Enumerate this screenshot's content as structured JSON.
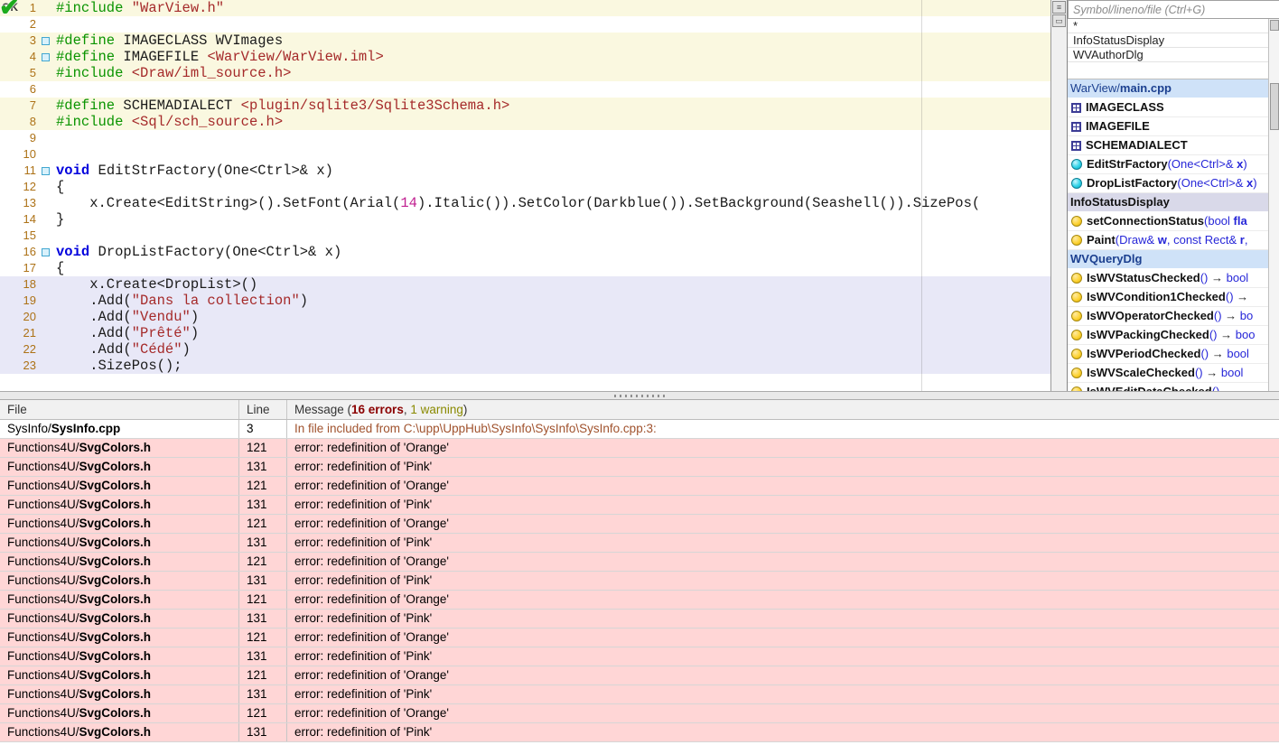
{
  "colors": {
    "error_row_bg": "#ffd6d6",
    "errors_text": "#8b0000",
    "warning_text": "#8a8a00",
    "selection_bg": "#d9d9e9",
    "file_row_bg": "#cfe2f8"
  },
  "editor": {
    "status": "OK",
    "lines": [
      {
        "num": "1",
        "bg": "y",
        "marker": false,
        "segments": [
          {
            "t": "#include",
            "c": "pp"
          },
          {
            "t": " ",
            "c": "pl"
          },
          {
            "t": "\"WarView.h\"",
            "c": "str"
          }
        ]
      },
      {
        "num": "2",
        "bg": "w",
        "marker": false,
        "segments": []
      },
      {
        "num": "3",
        "bg": "y",
        "marker": true,
        "segments": [
          {
            "t": "#define",
            "c": "pp"
          },
          {
            "t": " IMAGECLASS WVImages",
            "c": "pl"
          }
        ]
      },
      {
        "num": "4",
        "bg": "y",
        "marker": true,
        "segments": [
          {
            "t": "#define",
            "c": "pp"
          },
          {
            "t": " IMAGEFILE ",
            "c": "pl"
          },
          {
            "t": "<WarView/WarView.iml>",
            "c": "str"
          }
        ]
      },
      {
        "num": "5",
        "bg": "y",
        "marker": false,
        "segments": [
          {
            "t": "#include",
            "c": "pp"
          },
          {
            "t": " ",
            "c": "pl"
          },
          {
            "t": "<Draw/iml_source.h>",
            "c": "str"
          }
        ]
      },
      {
        "num": "6",
        "bg": "w",
        "marker": false,
        "segments": []
      },
      {
        "num": "7",
        "bg": "y",
        "marker": false,
        "segments": [
          {
            "t": "#define",
            "c": "pp"
          },
          {
            "t": " SCHEMADIALECT ",
            "c": "pl"
          },
          {
            "t": "<plugin/sqlite3/Sqlite3Schema.h>",
            "c": "str"
          }
        ]
      },
      {
        "num": "8",
        "bg": "y",
        "marker": false,
        "segments": [
          {
            "t": "#include",
            "c": "pp"
          },
          {
            "t": " ",
            "c": "pl"
          },
          {
            "t": "<Sql/sch_source.h>",
            "c": "str"
          }
        ]
      },
      {
        "num": "9",
        "bg": "w",
        "marker": false,
        "segments": []
      },
      {
        "num": "10",
        "bg": "w",
        "marker": false,
        "segments": []
      },
      {
        "num": "11",
        "bg": "w",
        "marker": true,
        "segments": [
          {
            "t": "void",
            "c": "kw"
          },
          {
            "t": " EditStrFactory(One<Ctrl>& x)",
            "c": "pl"
          }
        ]
      },
      {
        "num": "12",
        "bg": "w",
        "marker": false,
        "segments": [
          {
            "t": "{",
            "c": "pl"
          }
        ]
      },
      {
        "num": "13",
        "bg": "w",
        "marker": false,
        "segments": [
          {
            "t": "    x.Create<EditString>().SetFont(Arial(",
            "c": "pl"
          },
          {
            "t": "14",
            "c": "num"
          },
          {
            "t": ").Italic()).SetColor(Darkblue()).SetBackground(Seashell()).SizePos(",
            "c": "pl"
          }
        ]
      },
      {
        "num": "14",
        "bg": "w",
        "marker": false,
        "segments": [
          {
            "t": "}",
            "c": "pl"
          }
        ]
      },
      {
        "num": "15",
        "bg": "w",
        "marker": false,
        "segments": []
      },
      {
        "num": "16",
        "bg": "w",
        "marker": true,
        "segments": [
          {
            "t": "void",
            "c": "kw"
          },
          {
            "t": " DropListFactory(One<Ctrl>& x)",
            "c": "pl"
          }
        ]
      },
      {
        "num": "17",
        "bg": "w",
        "marker": false,
        "segments": [
          {
            "t": "{",
            "c": "pl"
          }
        ]
      },
      {
        "num": "18",
        "bg": "l",
        "marker": false,
        "segments": [
          {
            "t": "    x.Create<DropList>()",
            "c": "pl"
          }
        ]
      },
      {
        "num": "19",
        "bg": "l",
        "marker": false,
        "segments": [
          {
            "t": "    .Add(",
            "c": "pl"
          },
          {
            "t": "\"Dans la collection\"",
            "c": "str"
          },
          {
            "t": ")",
            "c": "pl"
          }
        ]
      },
      {
        "num": "20",
        "bg": "l",
        "marker": false,
        "segments": [
          {
            "t": "    .Add(",
            "c": "pl"
          },
          {
            "t": "\"Vendu\"",
            "c": "str"
          },
          {
            "t": ")",
            "c": "pl"
          }
        ]
      },
      {
        "num": "21",
        "bg": "l",
        "marker": false,
        "segments": [
          {
            "t": "    .Add(",
            "c": "pl"
          },
          {
            "t": "\"Prêté\"",
            "c": "str"
          },
          {
            "t": ")",
            "c": "pl"
          }
        ]
      },
      {
        "num": "22",
        "bg": "l",
        "marker": false,
        "segments": [
          {
            "t": "    .Add(",
            "c": "pl"
          },
          {
            "t": "\"Cédé\"",
            "c": "str"
          },
          {
            "t": ")",
            "c": "pl"
          }
        ]
      },
      {
        "num": "23",
        "bg": "l",
        "marker": false,
        "segments": [
          {
            "t": "    .SizePos();",
            "c": "pl"
          }
        ]
      }
    ]
  },
  "symbol_panel": {
    "search_placeholder": "Symbol/lineno/file (Ctrl+G)",
    "recent": [
      "*",
      "InfoStatusDisplay",
      "WVAuthorDlg"
    ],
    "items": [
      {
        "kind": "file",
        "segments": [
          {
            "t": "WarView/",
            "c": "file"
          },
          {
            "t": "main.cpp",
            "c": "fileb"
          }
        ]
      },
      {
        "kind": "define",
        "segments": [
          {
            "t": "IMAGECLASS",
            "c": "name"
          }
        ]
      },
      {
        "kind": "define",
        "segments": [
          {
            "t": "IMAGEFILE",
            "c": "name"
          }
        ]
      },
      {
        "kind": "define",
        "segments": [
          {
            "t": "SCHEMADIALECT",
            "c": "name"
          }
        ]
      },
      {
        "kind": "fn-public",
        "segments": [
          {
            "t": "EditStrFactory",
            "c": "name"
          },
          {
            "t": "(One<Ctrl>& ",
            "c": "type"
          },
          {
            "t": "x",
            "c": "param"
          },
          {
            "t": ")",
            "c": "type"
          }
        ]
      },
      {
        "kind": "fn-public",
        "segments": [
          {
            "t": "DropListFactory",
            "c": "name"
          },
          {
            "t": "(One<Ctrl>& ",
            "c": "type"
          },
          {
            "t": "x",
            "c": "param"
          },
          {
            "t": ")",
            "c": "type"
          }
        ]
      },
      {
        "kind": "selected",
        "segments": [
          {
            "t": "InfoStatusDisplay",
            "c": "name"
          }
        ]
      },
      {
        "kind": "fn-protected",
        "segments": [
          {
            "t": "setConnectionStatus",
            "c": "name"
          },
          {
            "t": "(bool ",
            "c": "type"
          },
          {
            "t": "fla",
            "c": "param"
          }
        ]
      },
      {
        "kind": "fn-protected",
        "segments": [
          {
            "t": "Paint",
            "c": "name"
          },
          {
            "t": "(Draw& ",
            "c": "type"
          },
          {
            "t": "w",
            "c": "param"
          },
          {
            "t": ", const Rect& ",
            "c": "type"
          },
          {
            "t": "r",
            "c": "param"
          },
          {
            "t": ",",
            "c": "type"
          }
        ]
      },
      {
        "kind": "file",
        "segments": [
          {
            "t": "WVQueryDlg",
            "c": "fileb"
          }
        ]
      },
      {
        "kind": "fn-protected",
        "segments": [
          {
            "t": "IsWVStatusChecked",
            "c": "name"
          },
          {
            "t": "()",
            "c": "type"
          },
          {
            "t": " → ",
            "c": "arrow"
          },
          {
            "t": "bool",
            "c": "type"
          }
        ]
      },
      {
        "kind": "fn-protected",
        "segments": [
          {
            "t": "IsWVCondition1Checked",
            "c": "name"
          },
          {
            "t": "()",
            "c": "type"
          },
          {
            "t": " →",
            "c": "arrow"
          }
        ]
      },
      {
        "kind": "fn-protected",
        "segments": [
          {
            "t": "IsWVOperatorChecked",
            "c": "name"
          },
          {
            "t": "()",
            "c": "type"
          },
          {
            "t": " → ",
            "c": "arrow"
          },
          {
            "t": "bo",
            "c": "type"
          }
        ]
      },
      {
        "kind": "fn-protected",
        "segments": [
          {
            "t": "IsWVPackingChecked",
            "c": "name"
          },
          {
            "t": "()",
            "c": "type"
          },
          {
            "t": " → ",
            "c": "arrow"
          },
          {
            "t": "boo",
            "c": "type"
          }
        ]
      },
      {
        "kind": "fn-protected",
        "segments": [
          {
            "t": "IsWVPeriodChecked",
            "c": "name"
          },
          {
            "t": "()",
            "c": "type"
          },
          {
            "t": " → ",
            "c": "arrow"
          },
          {
            "t": "bool",
            "c": "type"
          }
        ]
      },
      {
        "kind": "fn-protected",
        "segments": [
          {
            "t": "IsWVScaleChecked",
            "c": "name"
          },
          {
            "t": "()",
            "c": "type"
          },
          {
            "t": " → ",
            "c": "arrow"
          },
          {
            "t": "bool",
            "c": "type"
          }
        ]
      },
      {
        "kind": "fn-protected",
        "segments": [
          {
            "t": "IsWVEditDataChecked",
            "c": "name"
          },
          {
            "t": "()",
            "c": "type"
          }
        ]
      }
    ]
  },
  "console": {
    "header": {
      "file": "File",
      "line": "Line",
      "message_prefix": "Message (",
      "errors": "16 errors",
      "comma": ", ",
      "warning": "1 warning",
      "close": ")"
    },
    "rows": [
      {
        "type": "note",
        "dir": "SysInfo/",
        "name": "SysInfo.cpp",
        "line": "3",
        "message": "In file included from C:\\upp\\UppHub\\SysInfo\\SysInfo\\SysInfo.cpp:3:"
      },
      {
        "type": "error",
        "dir": "Functions4U/",
        "name": "SvgColors.h",
        "line": "121",
        "message": "error: redefinition of 'Orange'"
      },
      {
        "type": "error",
        "dir": "Functions4U/",
        "name": "SvgColors.h",
        "line": "131",
        "message": "error: redefinition of 'Pink'"
      },
      {
        "type": "error",
        "dir": "Functions4U/",
        "name": "SvgColors.h",
        "line": "121",
        "message": "error: redefinition of 'Orange'"
      },
      {
        "type": "error",
        "dir": "Functions4U/",
        "name": "SvgColors.h",
        "line": "131",
        "message": "error: redefinition of 'Pink'"
      },
      {
        "type": "error",
        "dir": "Functions4U/",
        "name": "SvgColors.h",
        "line": "121",
        "message": "error: redefinition of 'Orange'"
      },
      {
        "type": "error",
        "dir": "Functions4U/",
        "name": "SvgColors.h",
        "line": "131",
        "message": "error: redefinition of 'Pink'"
      },
      {
        "type": "error",
        "dir": "Functions4U/",
        "name": "SvgColors.h",
        "line": "121",
        "message": "error: redefinition of 'Orange'"
      },
      {
        "type": "error",
        "dir": "Functions4U/",
        "name": "SvgColors.h",
        "line": "131",
        "message": "error: redefinition of 'Pink'"
      },
      {
        "type": "error",
        "dir": "Functions4U/",
        "name": "SvgColors.h",
        "line": "121",
        "message": "error: redefinition of 'Orange'"
      },
      {
        "type": "error",
        "dir": "Functions4U/",
        "name": "SvgColors.h",
        "line": "131",
        "message": "error: redefinition of 'Pink'"
      },
      {
        "type": "error",
        "dir": "Functions4U/",
        "name": "SvgColors.h",
        "line": "121",
        "message": "error: redefinition of 'Orange'"
      },
      {
        "type": "error",
        "dir": "Functions4U/",
        "name": "SvgColors.h",
        "line": "131",
        "message": "error: redefinition of 'Pink'"
      },
      {
        "type": "error",
        "dir": "Functions4U/",
        "name": "SvgColors.h",
        "line": "121",
        "message": "error: redefinition of 'Orange'"
      },
      {
        "type": "error",
        "dir": "Functions4U/",
        "name": "SvgColors.h",
        "line": "131",
        "message": "error: redefinition of 'Pink'"
      },
      {
        "type": "error",
        "dir": "Functions4U/",
        "name": "SvgColors.h",
        "line": "121",
        "message": "error: redefinition of 'Orange'"
      },
      {
        "type": "error",
        "dir": "Functions4U/",
        "name": "SvgColors.h",
        "line": "131",
        "message": "error: redefinition of 'Pink'"
      }
    ]
  }
}
